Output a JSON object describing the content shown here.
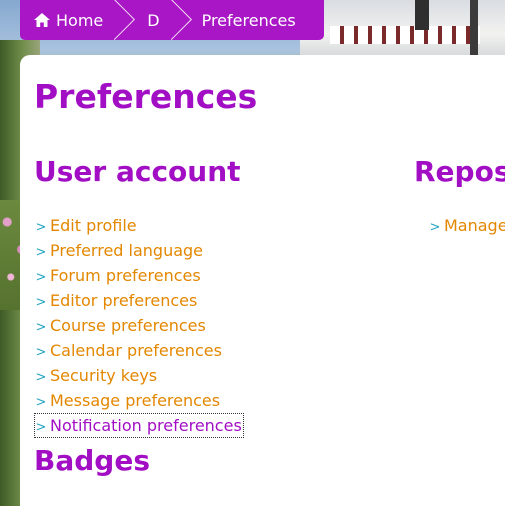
{
  "breadcrumb": {
    "items": [
      {
        "label": "Home",
        "icon": "home-icon"
      },
      {
        "label": "D"
      },
      {
        "label": "Preferences"
      }
    ]
  },
  "page": {
    "title": "Preferences"
  },
  "sections": {
    "user_account": {
      "title": "User account",
      "links": [
        "Edit profile",
        "Preferred language",
        "Forum preferences",
        "Editor preferences",
        "Course preferences",
        "Calendar preferences",
        "Security keys",
        "Message preferences",
        "Notification preferences"
      ],
      "focused_index": 8
    },
    "repositories": {
      "title": "Repos",
      "links": [
        "Manage"
      ]
    },
    "badges": {
      "title": "Badges"
    }
  },
  "colors": {
    "accent": "#a20ec4",
    "breadcrumb_bg": "#a916c6",
    "link": "#e38700",
    "chevron": "#25a4c0",
    "focused_link": "#a20ec4"
  }
}
